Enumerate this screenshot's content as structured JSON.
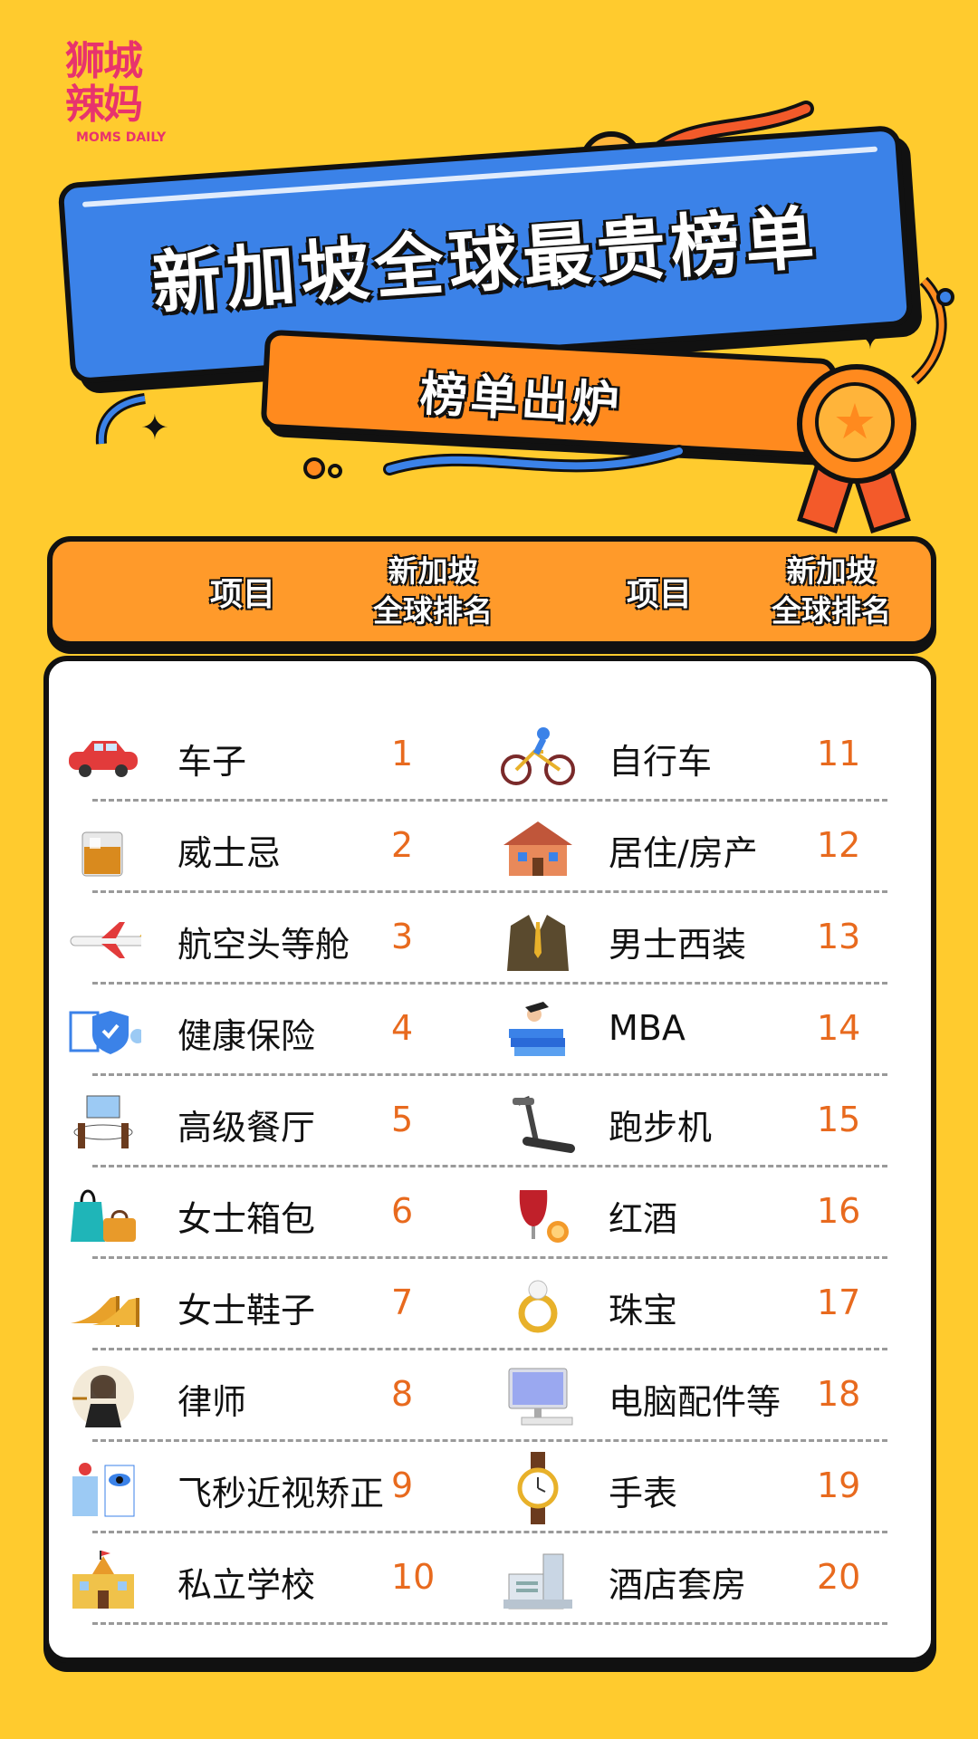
{
  "logo": {
    "line1": "狮城",
    "line2": "辣妈",
    "sub": "MOMS DAILY"
  },
  "title": "新加坡全球最贵榜单",
  "subtitle": "榜单出炉",
  "header": {
    "col1": "项目",
    "col2_line1": "新加坡",
    "col2_line2": "全球排名",
    "col3": "项目",
    "col4_line1": "新加坡",
    "col4_line2": "全球排名"
  },
  "colors": {
    "background": "#FFCB2E",
    "banner_blue": "#3B82E8",
    "accent_orange": "#FF9A2A",
    "rank_text": "#E86A1E"
  },
  "rows": [
    {
      "left": {
        "name": "车子",
        "rank": "1",
        "icon": "car-icon"
      },
      "right": {
        "name": "自行车",
        "rank": "11",
        "icon": "cyclist-icon"
      }
    },
    {
      "left": {
        "name": "威士忌",
        "rank": "2",
        "icon": "whisky-icon"
      },
      "right": {
        "name": "居住/房产",
        "rank": "12",
        "icon": "house-icon"
      }
    },
    {
      "left": {
        "name": "航空头等舱",
        "rank": "3",
        "icon": "airplane-icon"
      },
      "right": {
        "name": "男士西装",
        "rank": "13",
        "icon": "suit-icon"
      }
    },
    {
      "left": {
        "name": "健康保险",
        "rank": "4",
        "icon": "insurance-icon"
      },
      "right": {
        "name": "MBA",
        "rank": "14",
        "icon": "graduation-icon"
      }
    },
    {
      "left": {
        "name": "高级餐厅",
        "rank": "5",
        "icon": "restaurant-icon"
      },
      "right": {
        "name": "跑步机",
        "rank": "15",
        "icon": "treadmill-icon"
      }
    },
    {
      "left": {
        "name": "女士箱包",
        "rank": "6",
        "icon": "handbag-icon"
      },
      "right": {
        "name": "红酒",
        "rank": "16",
        "icon": "wine-icon"
      }
    },
    {
      "left": {
        "name": "女士鞋子",
        "rank": "7",
        "icon": "heels-icon"
      },
      "right": {
        "name": "珠宝",
        "rank": "17",
        "icon": "ring-icon"
      }
    },
    {
      "left": {
        "name": "律师",
        "rank": "8",
        "icon": "lawyer-icon"
      },
      "right": {
        "name": "电脑配件等",
        "rank": "18",
        "icon": "computer-icon"
      }
    },
    {
      "left": {
        "name": "飞秒近视矫正",
        "rank": "9",
        "icon": "eye-clinic-icon"
      },
      "right": {
        "name": "手表",
        "rank": "19",
        "icon": "watch-icon"
      }
    },
    {
      "left": {
        "name": "私立学校",
        "rank": "10",
        "icon": "school-icon"
      },
      "right": {
        "name": "酒店套房",
        "rank": "20",
        "icon": "hotel-icon"
      }
    }
  ]
}
